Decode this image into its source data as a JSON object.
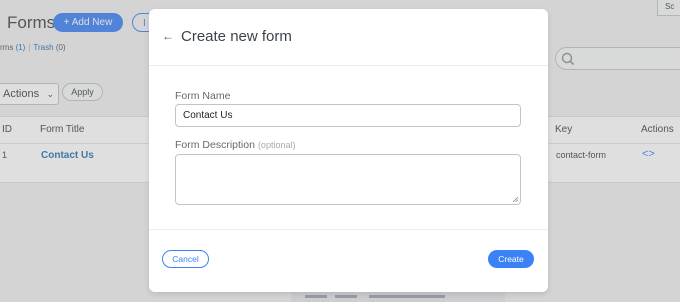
{
  "background": {
    "page_title": "Forms",
    "add_new_label": "+ Add New",
    "import_label": "I",
    "screen_options_label": "Sc",
    "subsubsub": {
      "all_label": "rms",
      "all_count": "(1)",
      "separator": "|",
      "trash_label": "Trash",
      "trash_count": "(0)"
    },
    "bulk_actions": {
      "selected": "Actions",
      "apply_label": "Apply"
    },
    "table": {
      "headers": {
        "id": "ID",
        "title": "Form Title",
        "key": "Key",
        "actions": "Actions"
      },
      "rows": [
        {
          "id": "1",
          "title": "Contact Us",
          "key": "contact-form",
          "actions_icon": "<>"
        }
      ]
    }
  },
  "modal": {
    "title": "Create new form",
    "back_icon": "arrow-left-icon",
    "form_name": {
      "label": "Form Name",
      "value": "Contact Us"
    },
    "form_description": {
      "label": "Form Description",
      "optional_label": "(optional)",
      "value": ""
    },
    "cancel_label": "Cancel",
    "create_label": "Create"
  },
  "colors": {
    "accent": "#3b82f6",
    "overlay": "rgba(140,140,140,0.28)",
    "link": "#2271b1"
  }
}
